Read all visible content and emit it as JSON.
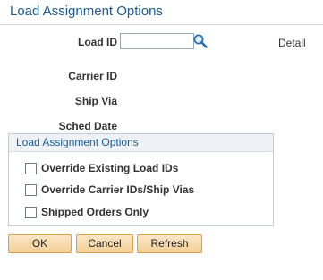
{
  "page": {
    "title": "Load Assignment Options"
  },
  "fields": {
    "load_id_label": "Load ID",
    "load_id_value": "",
    "carrier_id_label": "Carrier ID",
    "ship_via_label": "Ship Via",
    "sched_date_label": "Sched Date",
    "detail_link": "Detail"
  },
  "group": {
    "title": "Load Assignment Options",
    "options": [
      {
        "label": "Override Existing Load IDs",
        "checked": false
      },
      {
        "label": "Override Carrier IDs/Ship Vias",
        "checked": false
      },
      {
        "label": "Shipped Orders Only",
        "checked": false
      }
    ]
  },
  "buttons": {
    "ok": "OK",
    "cancel": "Cancel",
    "refresh": "Refresh"
  },
  "colors": {
    "title": "#1c5c8f",
    "button_fill": "#f4cf95",
    "button_border": "#d9a04f"
  },
  "icons": {
    "lookup": "magnifier-icon"
  }
}
